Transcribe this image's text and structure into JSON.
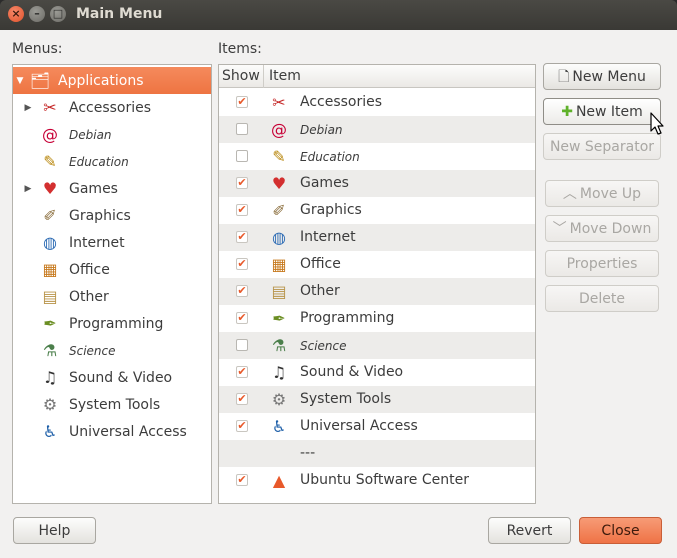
{
  "window": {
    "title": "Main Menu"
  },
  "menus_panel": {
    "caption": "Menus:",
    "items": [
      {
        "label": "Applications",
        "icon": "applications-icon",
        "selected": true,
        "expanded": true,
        "italic": false
      },
      {
        "label": "Accessories",
        "icon": "accessories-icon",
        "expandable": true,
        "italic": false
      },
      {
        "label": "Debian",
        "icon": "debian-icon",
        "italic": true
      },
      {
        "label": "Education",
        "icon": "education-icon",
        "italic": true
      },
      {
        "label": "Games",
        "icon": "games-icon",
        "expandable": true,
        "italic": false
      },
      {
        "label": "Graphics",
        "icon": "graphics-icon",
        "italic": false
      },
      {
        "label": "Internet",
        "icon": "internet-icon",
        "italic": false
      },
      {
        "label": "Office",
        "icon": "office-icon",
        "italic": false
      },
      {
        "label": "Other",
        "icon": "other-icon",
        "italic": false
      },
      {
        "label": "Programming",
        "icon": "programming-icon",
        "italic": false
      },
      {
        "label": "Science",
        "icon": "science-icon",
        "italic": true
      },
      {
        "label": "Sound & Video",
        "icon": "sound-video-icon",
        "italic": false
      },
      {
        "label": "System Tools",
        "icon": "system-tools-icon",
        "italic": false
      },
      {
        "label": "Universal Access",
        "icon": "universal-access-icon",
        "italic": false
      }
    ]
  },
  "items_panel": {
    "caption": "Items:",
    "columns": {
      "show": "Show",
      "item": "Item"
    },
    "rows": [
      {
        "label": "Accessories",
        "show": true,
        "italic": false,
        "icon": "accessories-icon"
      },
      {
        "label": "Debian",
        "show": false,
        "italic": true,
        "icon": "debian-icon"
      },
      {
        "label": "Education",
        "show": false,
        "italic": true,
        "icon": "education-icon"
      },
      {
        "label": "Games",
        "show": true,
        "italic": false,
        "icon": "games-icon"
      },
      {
        "label": "Graphics",
        "show": true,
        "italic": false,
        "icon": "graphics-icon"
      },
      {
        "label": "Internet",
        "show": true,
        "italic": false,
        "icon": "internet-icon"
      },
      {
        "label": "Office",
        "show": true,
        "italic": false,
        "icon": "office-icon"
      },
      {
        "label": "Other",
        "show": true,
        "italic": false,
        "icon": "other-icon"
      },
      {
        "label": "Programming",
        "show": true,
        "italic": false,
        "icon": "programming-icon"
      },
      {
        "label": "Science",
        "show": false,
        "italic": true,
        "icon": "science-icon"
      },
      {
        "label": "Sound & Video",
        "show": true,
        "italic": false,
        "icon": "sound-video-icon"
      },
      {
        "label": "System Tools",
        "show": true,
        "italic": false,
        "icon": "system-tools-icon"
      },
      {
        "label": "Universal Access",
        "show": true,
        "italic": false,
        "icon": "universal-access-icon"
      },
      {
        "label": "---",
        "separator": true
      },
      {
        "label": "Ubuntu Software Center",
        "show": true,
        "italic": false,
        "icon": "software-center-icon"
      }
    ]
  },
  "buttons": {
    "new_menu": "New Menu",
    "new_item": "New Item",
    "new_separator": "New Separator",
    "move_up": "Move Up",
    "move_down": "Move Down",
    "properties": "Properties",
    "delete": "Delete",
    "help": "Help",
    "revert": "Revert",
    "close": "Close"
  },
  "colors": {
    "accent": "#f07746",
    "selection": "#f07746",
    "check": "#e8592a"
  }
}
